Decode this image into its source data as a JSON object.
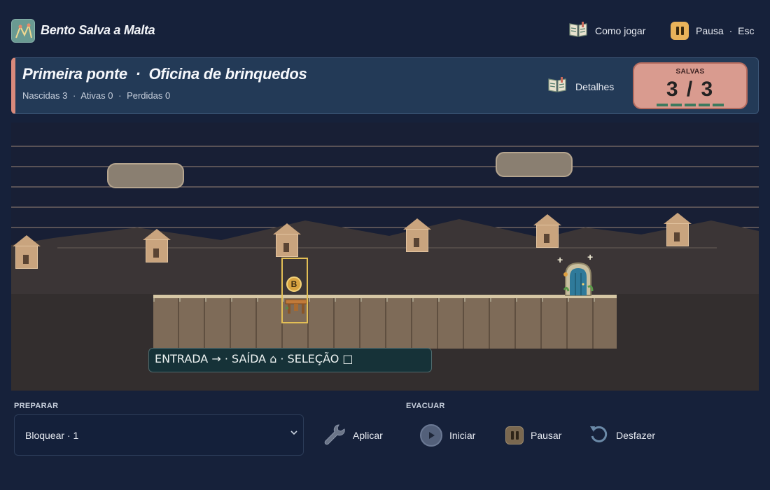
{
  "app": {
    "title": "Bento Salva a Malta",
    "logo_icon": "map-logo-icon",
    "how_to_play_label": "Como jogar",
    "how_to_play_icon": "book-icon",
    "pause_label": "Pausa",
    "pause_shortcut_sep": "·",
    "pause_shortcut": "Esc",
    "pause_icon": "pause-icon"
  },
  "level": {
    "title": "Primeira ponte",
    "title_sep": "·",
    "subtitle": "Oficina de brinquedos",
    "stats": {
      "born_label": "Nascidas",
      "born": "3",
      "active_label": "Ativas",
      "active": "0",
      "lost_label": "Perdidas",
      "lost": "0"
    },
    "details_label": "Detalhes",
    "details_icon": "book-icon",
    "accent_color": "#d98a7c"
  },
  "saved": {
    "label": "SALVAS",
    "value": "3 / 3",
    "progress_segments_filled": 5,
    "progress_segments_total": 5,
    "bar_color": "#3d7a5e",
    "box_color": "#d99b8f"
  },
  "stage": {
    "selected_token_label": "B",
    "entrance_icon": "entrance-stand-icon",
    "exit_icon": "exit-door-icon",
    "legend": "ENTRADA → · SAÍDA ⌂ · SELEÇÃO □"
  },
  "controls": {
    "prepare_label": "PREPARAR",
    "tool_select_value": "Bloquear · 1",
    "apply_label": "Aplicar",
    "apply_icon": "wrench-icon",
    "evacuate_label": "EVACUAR",
    "start_label": "Iniciar",
    "start_icon": "play-icon",
    "pause_label": "Pausar",
    "pause_icon": "pause-icon",
    "undo_label": "Desfazer",
    "undo_icon": "undo-icon"
  }
}
